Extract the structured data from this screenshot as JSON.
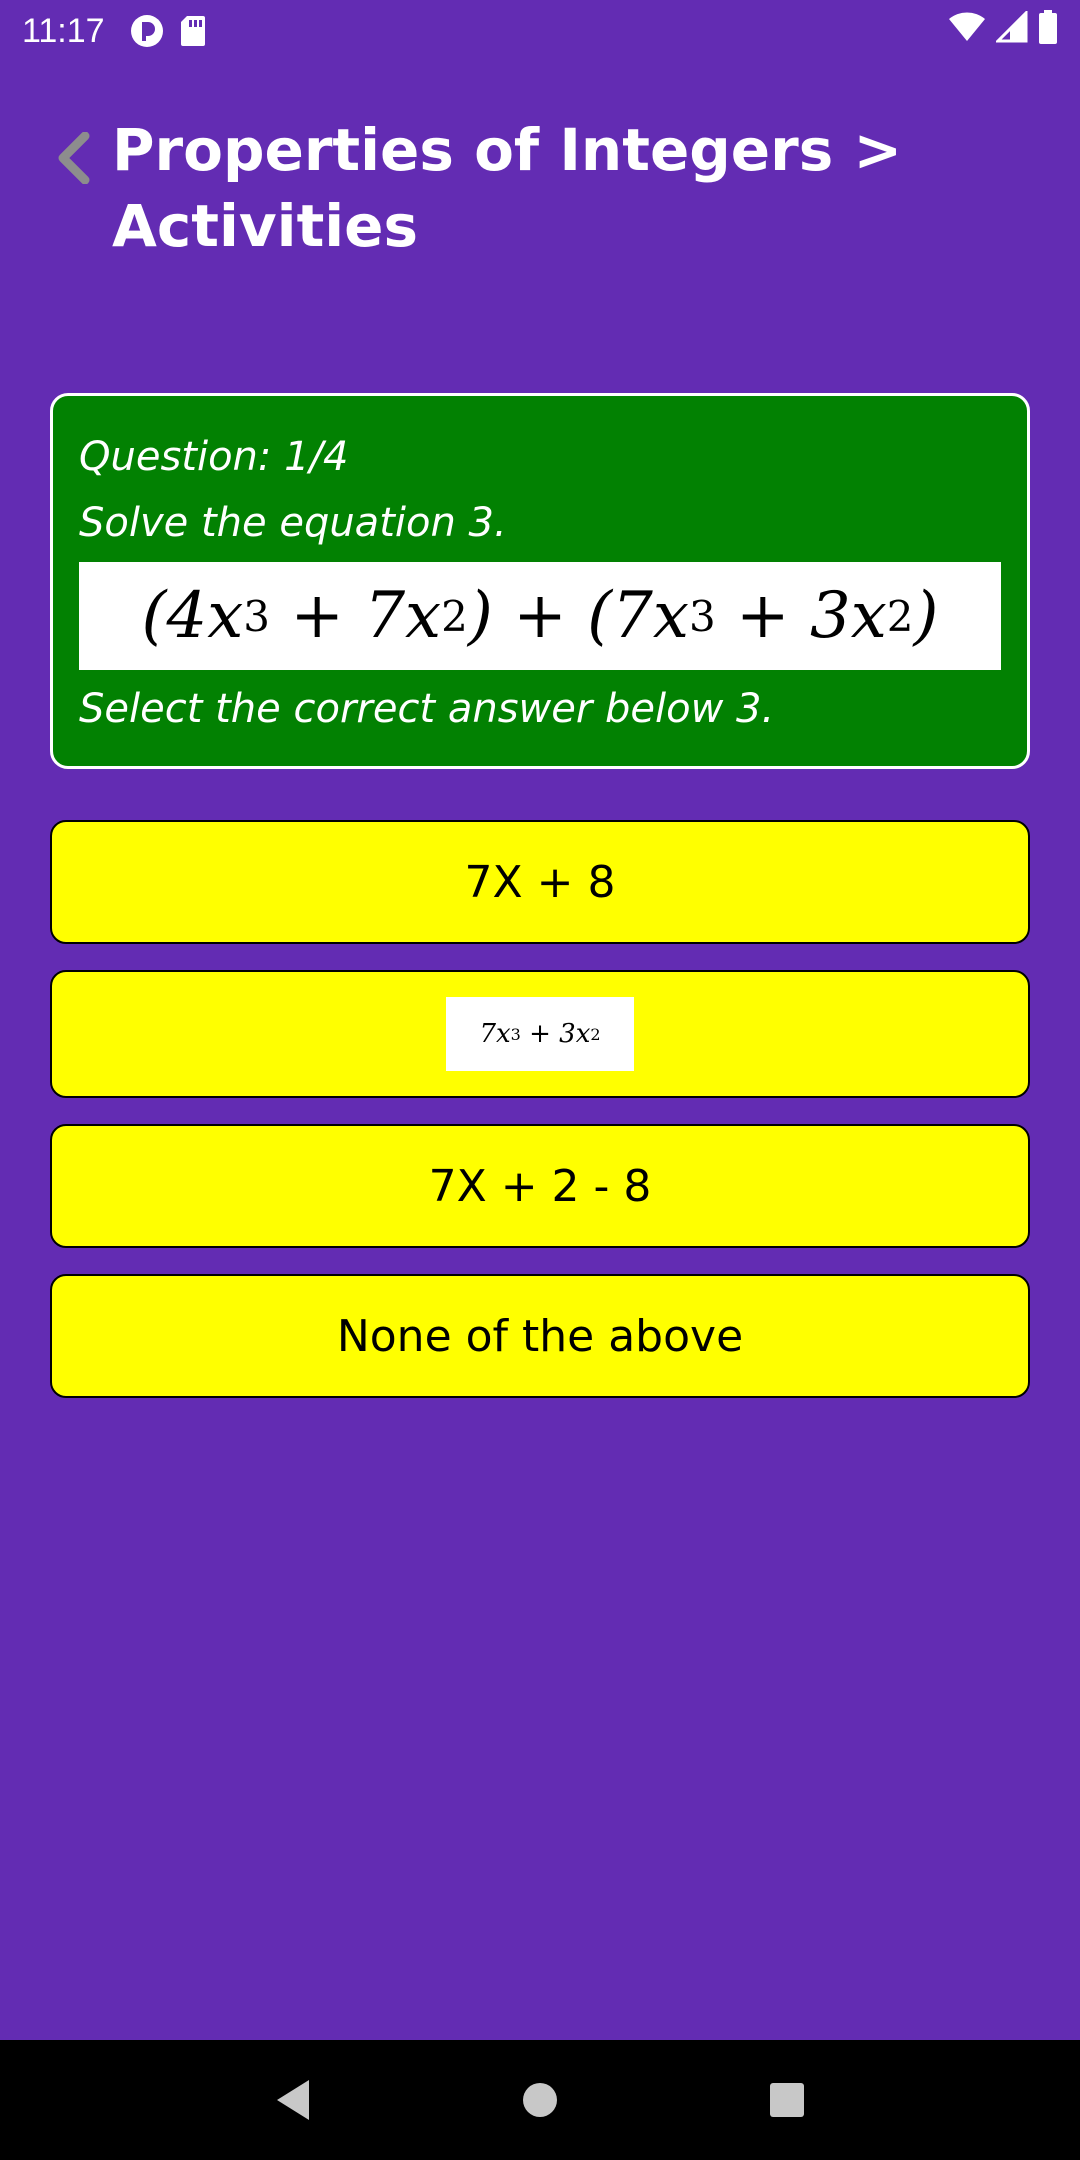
{
  "status_bar": {
    "time": "11:17",
    "icons_left": [
      "pocket-casts-icon",
      "sd-card-icon"
    ],
    "icons_right": [
      "wifi-icon",
      "cell-signal-icon",
      "battery-icon"
    ]
  },
  "header": {
    "back_icon": "chevron-left-icon",
    "title_line1": "Properties of Integers >",
    "title_line2": "Activities"
  },
  "question": {
    "counter": "Question: 1/4",
    "prompt": "Solve the equation 3.",
    "equation_parts": {
      "open1": "(4x",
      "exp1": "3",
      "plus1": " + 7x",
      "exp2": "2",
      "close_plus_open": ") + (7x",
      "exp3": "3",
      "plus2": " + 3x",
      "exp4": "2",
      "close2": ")"
    },
    "instruction": "Select the correct answer below 3."
  },
  "options": [
    {
      "label": "7X + 8"
    },
    {
      "equation": {
        "a": "7x",
        "e1": "3",
        "b": " + 3x",
        "e2": "2"
      }
    },
    {
      "label": "7X + 2 - 8"
    },
    {
      "label": "None of the above"
    }
  ],
  "nav_bar": {
    "back_icon": "nav-back-icon",
    "home_icon": "nav-home-icon",
    "recents_icon": "nav-recents-icon"
  },
  "colors": {
    "background": "#632cb3",
    "card": "#028102",
    "option": "#ffff00"
  }
}
